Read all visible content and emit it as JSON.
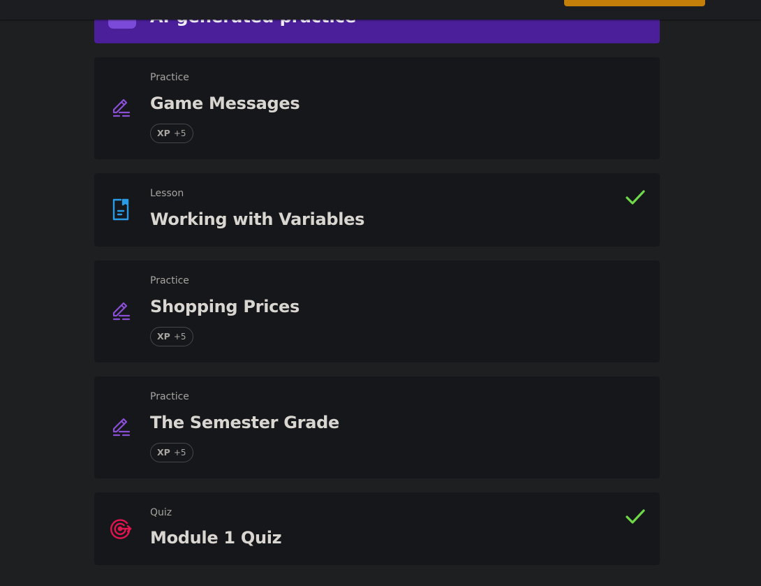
{
  "header": {
    "action_button_label": "",
    "accent_color": "#c47f0a"
  },
  "banner": {
    "title": "AI-generated practice",
    "background": "#4b1f9a"
  },
  "items": [
    {
      "kind": "Practice",
      "title": "Game Messages",
      "icon": "pencil-edit-icon",
      "xp_label": "XP",
      "xp_value": "+5",
      "completed": false
    },
    {
      "kind": "Lesson",
      "title": "Working with Variables",
      "icon": "lesson-document-icon",
      "completed": true
    },
    {
      "kind": "Practice",
      "title": "Shopping Prices",
      "icon": "pencil-edit-icon",
      "xp_label": "XP",
      "xp_value": "+5",
      "completed": false
    },
    {
      "kind": "Practice",
      "title": "The Semester Grade",
      "icon": "pencil-edit-icon",
      "xp_label": "XP",
      "xp_value": "+5",
      "completed": false
    },
    {
      "kind": "Quiz",
      "title": "Module 1 Quiz",
      "icon": "target-icon",
      "completed": true
    }
  ],
  "colors": {
    "practice_icon": "#8a4fd6",
    "lesson_icon": "#2a9be6",
    "quiz_icon": "#e0144f",
    "check": "#6fd94a",
    "card_background": "#16171a",
    "page_background": "#1e1f21"
  }
}
